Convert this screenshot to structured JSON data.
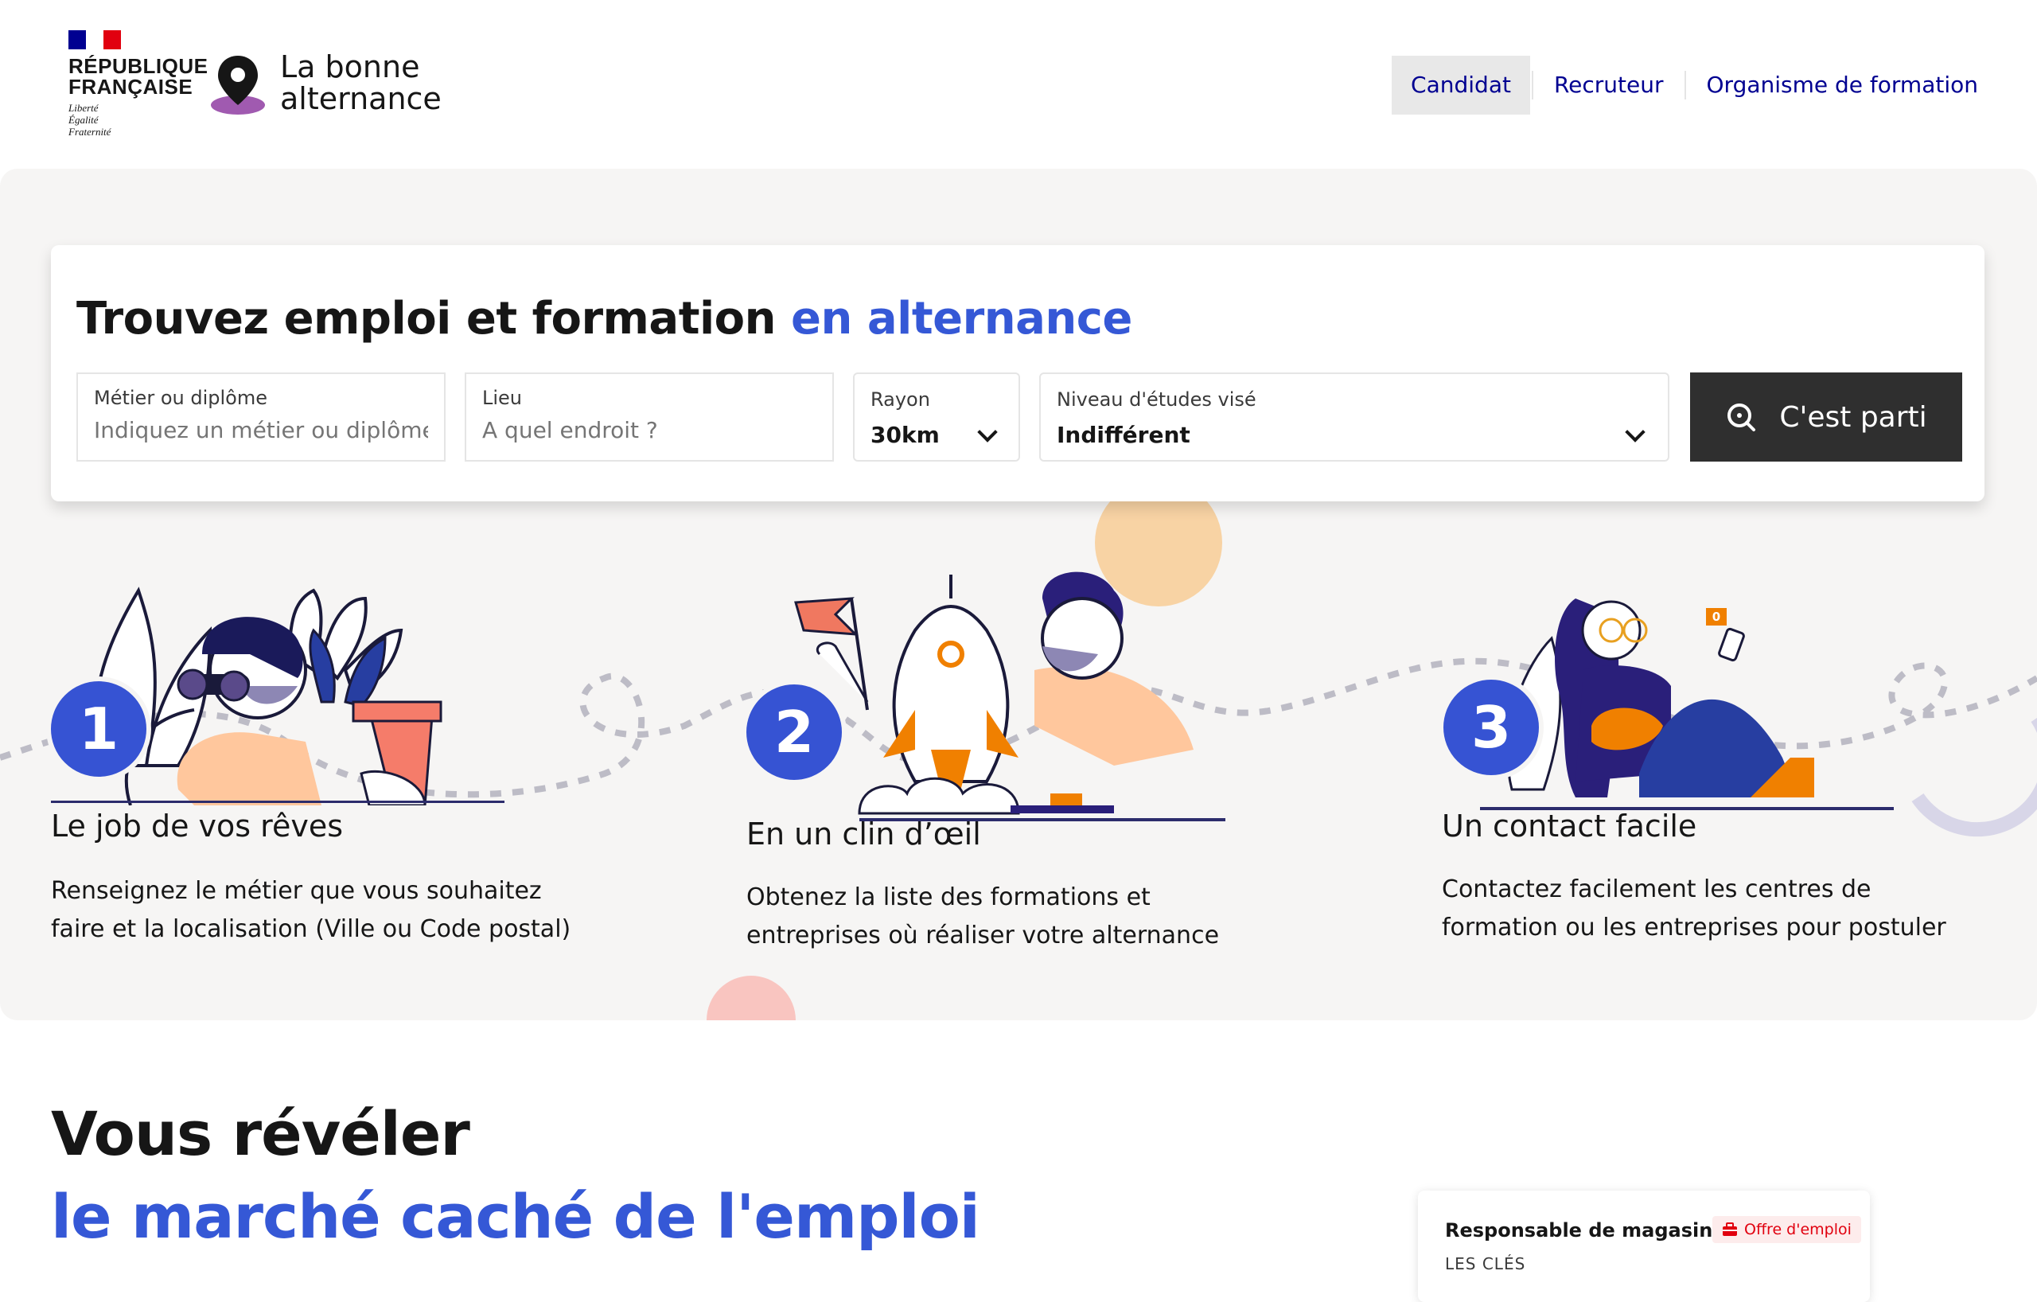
{
  "header": {
    "republique_line1": "RÉPUBLIQUE",
    "republique_line2": "FRANÇAISE",
    "devise": [
      "Liberté",
      "Égalité",
      "Fraternité"
    ],
    "brand_line1": "La bonne",
    "brand_line2": "alternance",
    "nav": [
      {
        "label": "Candidat",
        "active": true
      },
      {
        "label": "Recruteur",
        "active": false
      },
      {
        "label": "Organisme de formation",
        "active": false
      }
    ]
  },
  "search": {
    "title_main": "Trouvez emploi et formation",
    "title_accent": "en alternance",
    "metier": {
      "label": "Métier ou diplôme",
      "placeholder": "Indiquez un métier ou diplôme"
    },
    "lieu": {
      "label": "Lieu",
      "placeholder": "A quel endroit ?"
    },
    "rayon": {
      "label": "Rayon",
      "value": "30km"
    },
    "niveau": {
      "label": "Niveau d'études visé",
      "value": "Indifférent"
    },
    "submit_label": "C'est parti"
  },
  "steps": [
    {
      "number": "1",
      "title": "Le job de vos rêves",
      "desc_line1": "Renseignez le métier que vous souhaitez",
      "desc_line2": "faire et la localisation (Ville ou Code postal)"
    },
    {
      "number": "2",
      "title": "En un clin d’œil",
      "desc_line1": "Obtenez la liste des formations et",
      "desc_line2": "entreprises où réaliser votre alternance"
    },
    {
      "number": "3",
      "title": "Un contact facile",
      "desc_line1": "Contactez facilement les centres de",
      "desc_line2": "formation ou les entreprises pour postuler"
    }
  ],
  "notification_count": "0",
  "section": {
    "heading_line1": "Vous révéler",
    "heading_line2": "le marché caché de l'emploi"
  },
  "offer": {
    "title": "Responsable de magasin",
    "badge": "Offre d'emploi",
    "company": "LES CLÉS"
  },
  "colors": {
    "accent": "#3558d6",
    "navy": "#000091",
    "step_circle": "#3653d3",
    "orange": "#f08000",
    "peach": "#ffc79d",
    "hero_bg": "#f6f5f4"
  }
}
